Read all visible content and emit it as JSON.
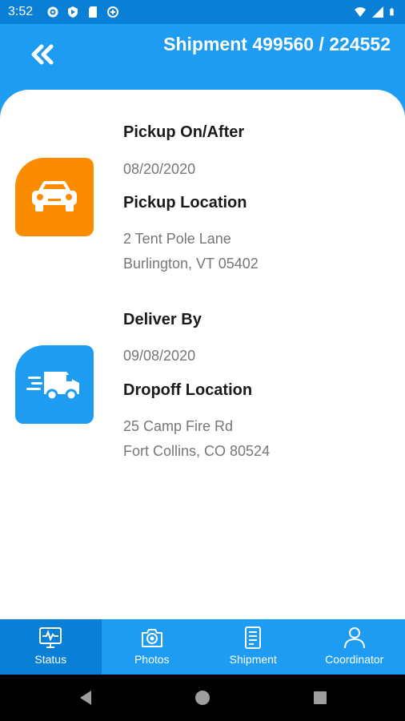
{
  "status_bar": {
    "time": "3:52"
  },
  "header": {
    "title": "Shipment 499560 / 224552"
  },
  "pickup": {
    "date_label": "Pickup On/After",
    "date": "08/20/2020",
    "location_label": "Pickup Location",
    "address_line1": "2 Tent  Pole Lane",
    "address_line2": "Burlington, VT 05402",
    "icon": "car-icon",
    "color": "#fb8c00"
  },
  "dropoff": {
    "date_label": "Deliver By",
    "date": "09/08/2020",
    "location_label": "Dropoff Location",
    "address_line1": "25 Camp Fire Rd",
    "address_line2": "Fort Collins, CO 80524",
    "icon": "delivery-van-icon",
    "color": "#1e9cf2"
  },
  "bottom_nav": {
    "items": [
      {
        "label": "Status",
        "icon": "monitor-pulse-icon",
        "active": true
      },
      {
        "label": "Photos",
        "icon": "camera-icon",
        "active": false
      },
      {
        "label": "Shipment",
        "icon": "document-icon",
        "active": false
      },
      {
        "label": "Coordinator",
        "icon": "person-icon",
        "active": false
      }
    ]
  },
  "colors": {
    "primary": "#1e9cf2",
    "primary_dark": "#0a7fd6",
    "accent": "#fb8c00"
  }
}
